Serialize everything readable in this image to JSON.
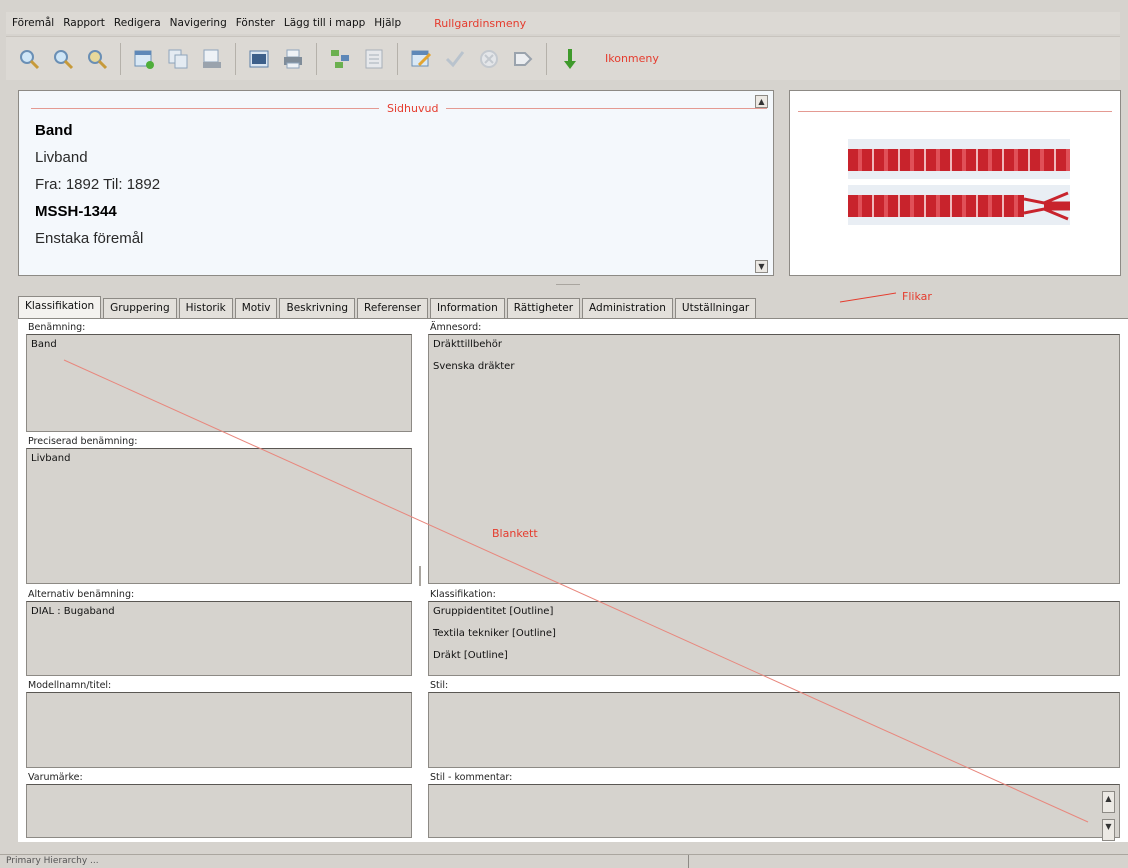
{
  "menubar": {
    "items": [
      "Föremål",
      "Rapport",
      "Redigera",
      "Navigering",
      "Fönster",
      "Lägg till i mapp",
      "Hjälp"
    ],
    "annotation": "Rullgardinsmeny"
  },
  "toolbar": {
    "annotation": "Ikonmeny",
    "groups": [
      [
        "zoom-in-icon",
        "zoom-out-icon",
        "search-record-icon"
      ],
      [
        "new-record-icon",
        "copy-record-icon",
        "save-record-icon"
      ],
      [
        "grid-view-icon",
        "print-icon"
      ],
      [
        "tree-view-icon",
        "list-view-icon"
      ],
      [
        "edit-icon",
        "check-icon",
        "cancel-icon",
        "tag-icon"
      ],
      [
        "download-arrow-icon"
      ]
    ]
  },
  "header": {
    "annotation": "Sidhuvud",
    "title": "Band",
    "subtitle": "Livband",
    "dates": "Fra: 1892 Til: 1892",
    "id": "MSSH-1344",
    "type": "Enstaka föremål"
  },
  "tabs": {
    "items": [
      "Klassifikation",
      "Gruppering",
      "Historik",
      "Motiv",
      "Beskrivning",
      "Referenser",
      "Information",
      "Rättigheter",
      "Administration",
      "Utställningar"
    ],
    "active": 0,
    "annotation": "Flikar"
  },
  "form": {
    "annotation": "Blankett",
    "benamning": {
      "label": "Benämning:",
      "values": [
        "Band"
      ]
    },
    "preciserad": {
      "label": "Preciserad benämning:",
      "values": [
        "Livband"
      ]
    },
    "alternativ": {
      "label": "Alternativ benämning:",
      "values": [
        "DIAL : Bugaband"
      ]
    },
    "modell": {
      "label": "Modellnamn/titel:",
      "values": []
    },
    "varumarke": {
      "label": "Varumärke:",
      "values": []
    },
    "amnesord": {
      "label": "Ämnesord:",
      "values": [
        "Dräkttillbehör",
        "Svenska dräkter"
      ]
    },
    "klassifikation": {
      "label": "Klassifikation:",
      "values": [
        "Gruppidentitet [Outline]",
        "Textila tekniker [Outline]",
        "Dräkt [Outline]"
      ]
    },
    "stil": {
      "label": "Stil:",
      "values": []
    },
    "stil_kommentar": {
      "label": "Stil - kommentar:",
      "values": []
    }
  },
  "status": {
    "left": "Primary Hierarchy ..."
  },
  "colors": {
    "annotation_red": "#e53c2e",
    "window_gray": "#d6d3ce",
    "header_bg": "#f4f8fc",
    "ribbon_red": "#c8232c"
  }
}
